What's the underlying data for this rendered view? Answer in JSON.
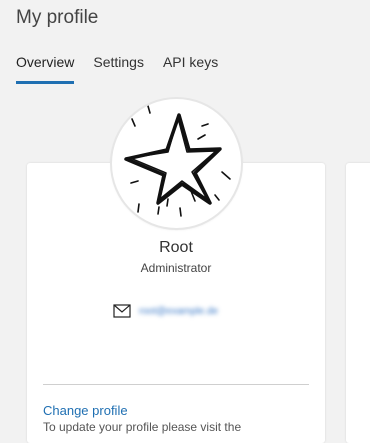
{
  "page": {
    "title": "My profile"
  },
  "tabs": [
    {
      "label": "Overview",
      "active": true
    },
    {
      "label": "Settings",
      "active": false
    },
    {
      "label": "API keys",
      "active": false
    }
  ],
  "profile": {
    "avatar_icon": "star-drawing-icon",
    "name": "Root",
    "role": "Administrator",
    "email_icon": "mail-icon",
    "email": "root@example.de",
    "change_link": "Change profile",
    "update_text": "To update your profile please visit the"
  },
  "colors": {
    "accent": "#1f6fb2",
    "background": "#f2f2f2",
    "card": "#ffffff"
  }
}
